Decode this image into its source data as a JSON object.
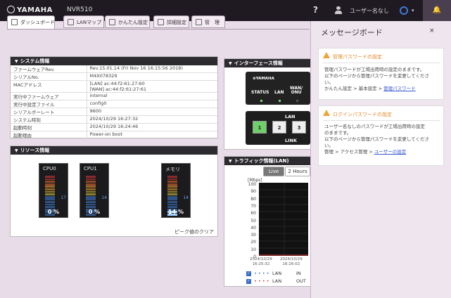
{
  "header": {
    "logo": "YAMAHA",
    "model": "NVR510",
    "help": "?",
    "username": "ユーザー名なし",
    "caret": "▾",
    "bell": "🔔"
  },
  "tabs": [
    {
      "label": "ダッシュボード"
    },
    {
      "label": "LANマップ"
    },
    {
      "label": "かんたん設定"
    },
    {
      "label": "詳細設定"
    },
    {
      "label": "管　理"
    }
  ],
  "system_info": {
    "title": "システム情報",
    "rows": [
      {
        "key": "ファームウェアRev.",
        "value": "Rev.15.01.14 (Fri Nov 16 16:15:56 2018)"
      },
      {
        "key": "シリアルNo.",
        "value": "M4X078329"
      },
      {
        "key": "MACアドレス",
        "value": "[LAN] ac:44:f2:61:27:60",
        "value2": "[WAN] ac:44:f2:61:27:61"
      },
      {
        "key": "実行中ファームウェア",
        "value": "internal"
      },
      {
        "key": "実行中設定ファイル",
        "value": "config0"
      },
      {
        "key": "シリアルボーレート",
        "value": "9600"
      },
      {
        "key": "システム時刻",
        "value": "2024/10/29 16:27:32"
      },
      {
        "key": "起動時刻",
        "value": "2024/10/29 16:24:46"
      },
      {
        "key": "起動理由",
        "value": "Power-on boot"
      }
    ]
  },
  "resources": {
    "title": "リソース情報",
    "gauges": [
      {
        "label": "CPU0",
        "marker": "17",
        "percent": "0 %",
        "level": 0.0
      },
      {
        "label": "CPU1",
        "marker": "14",
        "percent": "0 %",
        "level": 0.0
      },
      {
        "label": "メモリ",
        "marker": "14",
        "percent": "14 %",
        "level": 0.14
      }
    ],
    "peak_clear": "ピーク値のクリア"
  },
  "interface": {
    "title": "インターフェース情報",
    "device_logo": "⊛YAMAHA",
    "status": "STATUS",
    "lan": "LAN",
    "wan": "WAN/",
    "onu": "ONU",
    "ports_label": "LAN",
    "link_label": "LINK",
    "ports": [
      "1",
      "2",
      "3"
    ]
  },
  "traffic": {
    "title": "トラフィック情報(LAN)",
    "buttons": [
      "Live",
      "2 Hours"
    ],
    "unit": "[Mbps]",
    "yticks": [
      "100",
      "90",
      "80",
      "70",
      "60",
      "50",
      "40",
      "30",
      "20",
      "10",
      "0"
    ],
    "xticks": [
      {
        "date": "2024/10/29",
        "time": "16:25:32"
      },
      {
        "date": "2024/10/29",
        "time": "16:26:02"
      }
    ],
    "legend": [
      {
        "check": "✓",
        "line": "• • • •",
        "label": "LAN",
        "dir": "IN"
      },
      {
        "check": "✓",
        "line": "• • • •",
        "label": "LAN",
        "dir": "OUT"
      }
    ]
  },
  "board": {
    "title": "メッセージボード",
    "close": "×",
    "messages": [
      {
        "title": "管理パスワードの設定",
        "line1": "管理パスワードが工場出荷時の設定のままです。",
        "line2": "以下のページから管理パスワードを変更してくださ",
        "line3": "い。",
        "path": "かんたん設定 > 基本設定 > ",
        "link": "管理パスワード"
      },
      {
        "title": "ログインパスワードの設定",
        "line1": "ユーザー名なしのパスワードが工場出荷時の設定",
        "line2": "のままです。",
        "line3": "以下のページから管理パスワードを変更してくださ",
        "line4": "い。",
        "path": "管理 > アクセス管理 > ",
        "link": "ユーザーの設定"
      }
    ]
  },
  "colors": {
    "topbar": "#1f1a22",
    "accent_blue": "#3d7bd9",
    "warn_orange": "#f0a23a",
    "link_green": "#6fcf6a"
  }
}
